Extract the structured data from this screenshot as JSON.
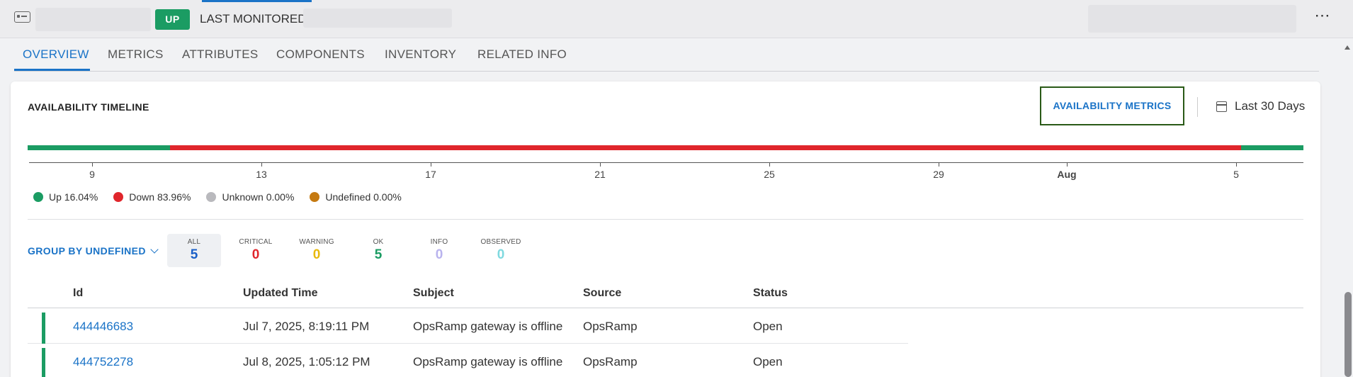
{
  "header": {
    "status_badge": "UP",
    "last_monitored_label": "LAST MONITORED",
    "more_icon": "ellipsis-icon",
    "device_icon": "device-icon"
  },
  "tabs": [
    {
      "label": "OVERVIEW",
      "active": true
    },
    {
      "label": "METRICS"
    },
    {
      "label": "ATTRIBUTES"
    },
    {
      "label": "COMPONENTS"
    },
    {
      "label": "INVENTORY"
    },
    {
      "label": "RELATED INFO"
    }
  ],
  "availability": {
    "title": "AVAILABILITY TIMELINE",
    "metrics_button": "AVAILABILITY METRICS",
    "range_label": "Last 30 Days",
    "range_icon": "calendar-icon",
    "axis_ticks": [
      "9",
      "13",
      "17",
      "21",
      "25",
      "29",
      "Aug",
      "5"
    ],
    "segments": [
      {
        "status": "up",
        "fraction": 0.1116
      },
      {
        "status": "down",
        "fraction": 0.8397
      },
      {
        "status": "up",
        "fraction": 0.0487
      }
    ],
    "legend": [
      {
        "label": "Up 16.04%",
        "color": "#1b9c63"
      },
      {
        "label": "Down 83.96%",
        "color": "#e0262c"
      },
      {
        "label": "Unknown 0.00%",
        "color": "#b9b9bd"
      },
      {
        "label": "Undefined 0.00%",
        "color": "#c57a12"
      }
    ]
  },
  "alerts": {
    "group_by_label": "GROUP BY UNDEFINED",
    "severities": [
      {
        "label": "ALL",
        "count": "5",
        "color": "#1a5fc7",
        "active": true
      },
      {
        "label": "CRITICAL",
        "count": "0",
        "color": "#e0262c"
      },
      {
        "label": "WARNING",
        "count": "0",
        "color": "#e8b90c"
      },
      {
        "label": "OK",
        "count": "5",
        "color": "#1b9c63"
      },
      {
        "label": "INFO",
        "count": "0",
        "color": "#b9b3ee"
      },
      {
        "label": "OBSERVED",
        "count": "0",
        "color": "#7fd9df"
      }
    ],
    "columns": [
      "Id",
      "Updated Time",
      "Subject",
      "Source",
      "Status"
    ],
    "rows": [
      {
        "id": "444446683",
        "updated": "Jul 7, 2025, 8:19:11 PM",
        "subject": "OpsRamp gateway is offline",
        "source": "OpsRamp",
        "status": "Open"
      },
      {
        "id": "444752278",
        "updated": "Jul 8, 2025, 1:05:12 PM",
        "subject": "OpsRamp gateway is offline",
        "source": "OpsRamp",
        "status": "Open"
      }
    ]
  },
  "colors": {
    "accent": "#1a73c7",
    "up": "#1b9c63",
    "down": "#e0262c"
  }
}
